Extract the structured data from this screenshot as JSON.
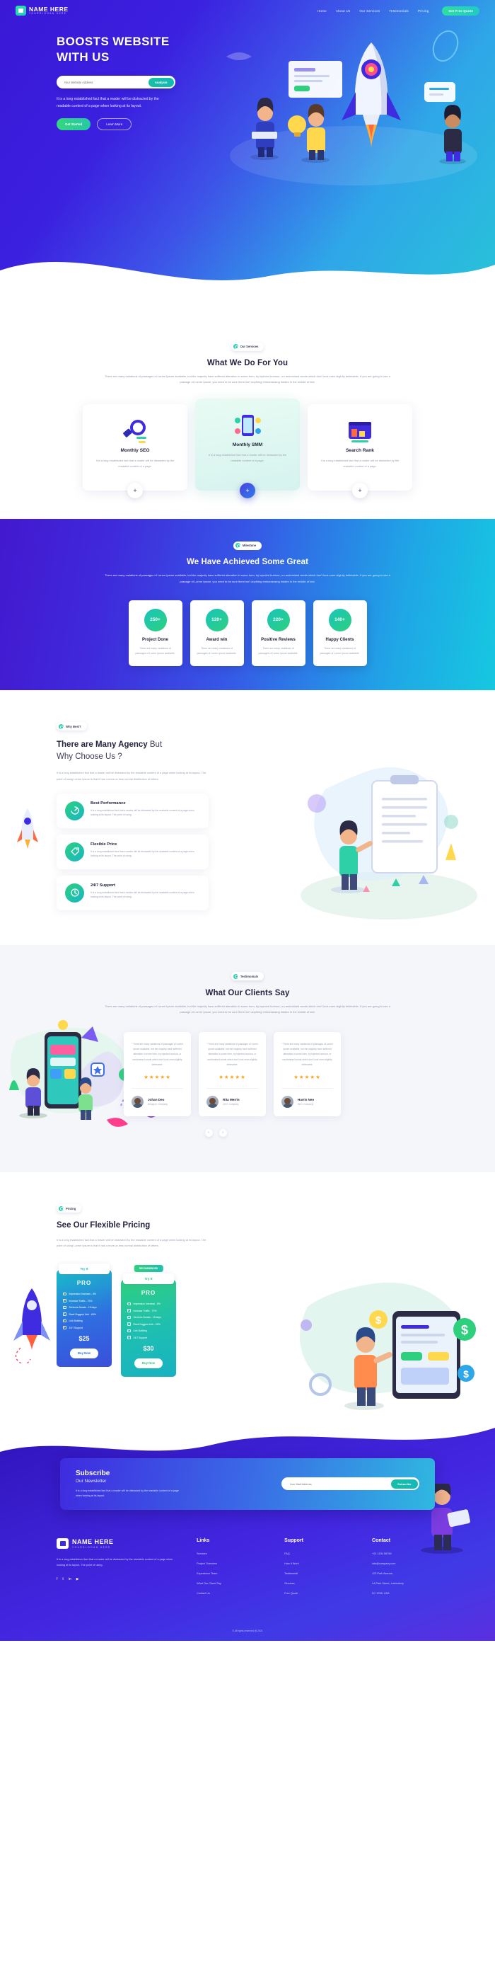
{
  "brand": {
    "name": "NAME HERE",
    "slogan": "YOURSLOGAN HERE"
  },
  "nav": {
    "links": [
      {
        "label": "Home"
      },
      {
        "label": "About Us"
      },
      {
        "label": "Our Services"
      },
      {
        "label": "Testimonials"
      },
      {
        "label": "Pricing"
      }
    ],
    "cta": "Get Free Quote"
  },
  "hero": {
    "title_line1": "BOOSTS WEBSITE",
    "title_line2": "WITH US",
    "input_placeholder": "Your Website Address",
    "analyze_button": "Analysis",
    "paragraph": "It is a long established fact that a reader will be distracted by the readable content of a page when looking at its layout.",
    "btn_primary": "Get Started",
    "btn_secondary": "Learn More"
  },
  "services": {
    "pill": "Our Services",
    "title": "What We Do For You",
    "subtitle": "There are many variations of passages of Lorem Ipsum available, but the majority have suffered alteration in some form, by injected humour, or randomised words which don't look even slightly believable. If you are going to use a passage of Lorem Ipsum, you need to be sure there isn't anything embarrassing hidden in the middle of text.",
    "cards": [
      {
        "icon": "magnifier-chart-icon",
        "title": "Monthly SEO",
        "text": "It is a long established fact that a reader will be distracted by the readable content of a page.",
        "plus": "+"
      },
      {
        "icon": "mobile-social-icon",
        "title": "Monthly SMM",
        "text": "It is a long established fact that a reader will be distracted by the readable content of a page.",
        "plus": "+"
      },
      {
        "icon": "browser-rank-icon",
        "title": "Search Rank",
        "text": "It is a long established fact that a reader will be distracted by the readable content of a page.",
        "plus": "+"
      }
    ]
  },
  "achieve": {
    "pill": "Milestone",
    "title": "We Have Achieved Some Great",
    "subtitle": "There are many variations of passages of Lorem Ipsum available, but the majority have suffered alteration in some form, by injected humour, or randomised words which don't look even slightly believable. If you are going to use a passage of Lorem Ipsum, you need to be sure there isn't anything embarrassing hidden in the middle of text.",
    "stats": [
      {
        "value": "250+",
        "label": "Project Done",
        "text": "There are many variations of passages of Lorem Ipsum available."
      },
      {
        "value": "120+",
        "label": "Award win",
        "text": "There are many variations of passages of Lorem Ipsum available."
      },
      {
        "value": "220+",
        "label": "Positive Reviews",
        "text": "There are many variations of passages of Lorem Ipsum available."
      },
      {
        "value": "140+",
        "label": "Happy Clients",
        "text": "There are many variations of passages of Lorem Ipsum available."
      }
    ]
  },
  "why": {
    "pill": "Why Best?",
    "title_bold": "There are Many Agency",
    "title_light": " But",
    "title_line2": "Why Choose Us ?",
    "paragraph": "It is a long established fact that a reader will be distracted by the readable content of a page when looking at its layout. The point of using Lorem Ipsum is that it has a more-or-less normal distribution of letters.",
    "features": [
      {
        "icon": "speed-gauge-icon",
        "glyph": "⚡",
        "title": "Best Performance",
        "text": "It is a long established fact that a reader will be distracted by the readable content of a page when looking at its layout. The point of using."
      },
      {
        "icon": "price-tag-icon",
        "glyph": "🏷",
        "title": "Flexible Price",
        "text": "It is a long established fact that a reader will be distracted by the readable content of a page when looking at its layout. The point of using."
      },
      {
        "icon": "support-clock-icon",
        "glyph": "☎",
        "title": "24/7 Support",
        "text": "It is a long established fact that a reader will be distracted by the readable content of a page when looking at its layout. The point of using."
      }
    ]
  },
  "testimonials": {
    "pill": "Testimonials",
    "title": "What Our Clients Say",
    "subtitle": "There are many variations of passages of Lorem Ipsum available, but the majority have suffered alteration in some form, by injected humour, or randomised words which don't look even slightly believable. If you are going to use a passage of Lorem Ipsum, you need to be sure there isn't anything embarrassing hidden in the middle of text.",
    "stars": "★★★★★",
    "prev": "‹",
    "next": "›",
    "items": [
      {
        "quote": "“ There are many variations of passages of Lorem Ipsum available, but the majority have suffered alteration in some form, by injected humour, or randomised words which don't look even slightly believable.",
        "name": "Johan Deo",
        "role": "Designer, Company"
      },
      {
        "quote": "“ There are many variations of passages of Lorem Ipsum available, but the majority have suffered alteration in some form, by injected humour, or randomised words which don't look even slightly believable.",
        "name": "Rita Merris",
        "role": "CEO, Company"
      },
      {
        "quote": "“ There are many variations of passages of Lorem Ipsum available, but the majority have suffered alteration in some form, by injected humour, or randomised words which don't look even slightly believable.",
        "name": "Harris Neo",
        "role": "SEO, Company"
      }
    ]
  },
  "pricing": {
    "pill": "Pricing",
    "title": "See Our Flexible Pricing",
    "paragraph": "It is a long established fact that a reader will be distracted by the readable content of a page when looking at its layout. The point of using Lorem Ipsum is that it has a more-or-less normal distribution of letters.",
    "plans": [
      {
        "tag": "Try It",
        "name": "PRO",
        "features": [
          "Impression Increase - 8%",
          "Increase Traffic - 70%",
          "Services Boosts - 15 days",
          "Rank Suggest Link - 60%",
          "Link Building",
          "24/7 Support"
        ],
        "price": "$25",
        "buy": "Buy Now"
      },
      {
        "ribbon": "RECOMMENDED",
        "tag": "Try It",
        "name": "PRO",
        "features": [
          "Impression Increase - 8%",
          "Increase Traffic - 70%",
          "Services Boosts - 15 days",
          "Rank Suggest Link - 60%",
          "Link Building",
          "24/7 Support"
        ],
        "price": "$30",
        "buy": "Buy Now"
      }
    ]
  },
  "subscribe": {
    "title": "Subscribe",
    "subtitle": "Our Newsletter",
    "text": "It is a long established fact that a reader will be distracted by the readable content of a page when looking at its layout.",
    "placeholder": "Your Mail Address",
    "button": "Subscribe"
  },
  "footer": {
    "about": "It is a long established fact that a reader will be distracted by the readable content of a page when looking at its layout. The point of using.",
    "social": [
      "f",
      "t",
      "in",
      "▶"
    ],
    "columns": [
      {
        "heading": "Links",
        "items": [
          "Services",
          "Project Overview",
          "Experience Team",
          "What Our Client Say",
          "Contact Us"
        ]
      },
      {
        "heading": "Support",
        "items": [
          "FAQ",
          "How It Work",
          "Testimonial",
          "Services",
          "Free Quote"
        ]
      },
      {
        "heading": "Contact",
        "items": [
          "+01 1234 56789",
          "info@company.com",
          "123 Park Avenue,",
          "LA Park Street, Laboratory",
          "NY 1298, USA"
        ]
      }
    ],
    "copyright": "© All rights reserved @ 2021"
  }
}
